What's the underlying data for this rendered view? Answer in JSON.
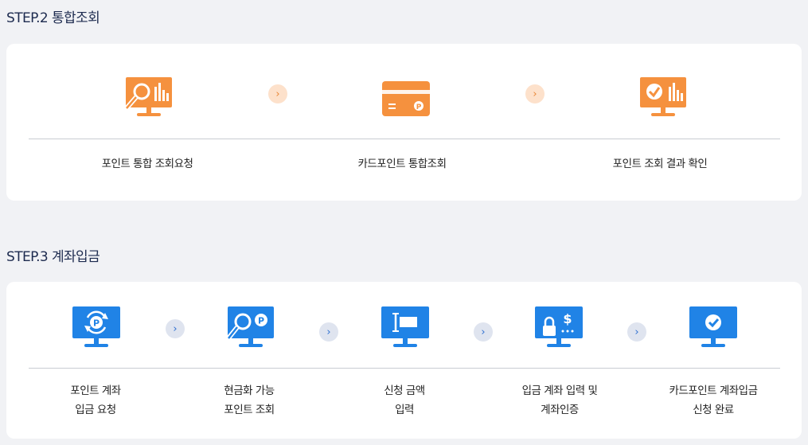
{
  "step2": {
    "title": "STEP.2 통합조회",
    "items": [
      {
        "label": "포인트 통합 조회요청",
        "icon": "search-chart-monitor-icon"
      },
      {
        "label": "카드포인트 통합조회",
        "icon": "point-card-icon"
      },
      {
        "label": "포인트 조회 결과 확인",
        "icon": "check-chart-monitor-icon"
      }
    ],
    "arrow": "›"
  },
  "step3": {
    "title": "STEP.3 계좌입금",
    "items": [
      {
        "line1": "포인트 계좌",
        "line2": "입금 요청",
        "icon": "point-refresh-monitor-icon"
      },
      {
        "line1": "현금화 가능",
        "line2": "포인트 조회",
        "icon": "point-search-monitor-icon"
      },
      {
        "line1": "신청 금액",
        "line2": "입력",
        "icon": "text-input-monitor-icon"
      },
      {
        "line1": "입금 계좌 입력 및",
        "line2": "계좌인증",
        "icon": "lock-dollar-monitor-icon"
      },
      {
        "line1": "카드포인트 계좌입금",
        "line2": "신청 완료",
        "icon": "check-monitor-icon"
      }
    ],
    "arrow": "›"
  },
  "colors": {
    "orange": "#f5913e",
    "blue": "#2083e6"
  }
}
